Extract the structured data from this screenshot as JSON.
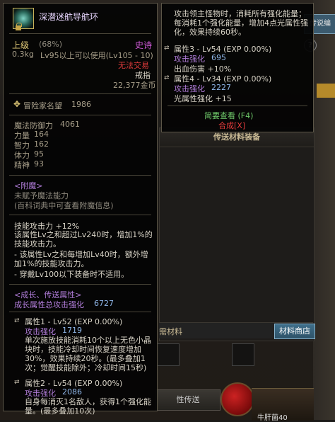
{
  "background": {
    "panel_title": "传送材料装备",
    "tab_label": "传说编",
    "help_label": "?",
    "materials_label": "需材料",
    "materials_shop": "材料商店",
    "bottom_button": "性传送",
    "hud_label": "牛肝菌40"
  },
  "tooltip": {
    "name": "深潜迷航导航环",
    "grade": "上级",
    "grade_pct": "(68%)",
    "rarity": "史诗",
    "weight": "0.3kg",
    "level_req": "Lv95以上可以使用(Lv105 - 10)",
    "trade": "无法交易",
    "slot": "戒指",
    "price": "22,377金币",
    "reputation_label": "冒险家名望",
    "reputation_value": "1986",
    "stats": [
      {
        "label": "魔法防御力",
        "value": "4061"
      },
      {
        "label": "力量",
        "value": "164"
      },
      {
        "label": "智力",
        "value": "162"
      },
      {
        "label": "体力",
        "value": "95"
      },
      {
        "label": "精神",
        "value": "93"
      }
    ],
    "enchant_header": "<附魔>",
    "enchant_none": "未赋予魔法能力",
    "enchant_hint": "(百科词典中可查看附魔信息)",
    "skill_line1": "技能攻击力 +12%",
    "skill_line2": "该属性Lv之和超过Lv240时，增加1%的技能攻击力。",
    "skill_line3": "- 该属性Lv之和每增加Lv40时，额外增加1%的技能攻击力。",
    "skill_line4": "- 穿戴Lv100以下装备时不适用。",
    "growth_header": "<成长、传送属性>",
    "growth_total_label": "成长属性总攻击强化",
    "growth_total_value": "6727",
    "attr1_header": "属性1 - Lv52 (EXP 0.00%)",
    "attr1_atk_label": "攻击强化",
    "attr1_atk_value": "1719",
    "attr1_desc": "单次施放技能消耗10个以上无色小晶块时，技能冷却时间恢复速度增加30%，效果持续20秒。(最多叠加1次；觉醒技能除外；冷却时间15秒)",
    "attr2_header": "属性2 - Lv54 (EXP 0.00%)",
    "attr2_atk_label": "攻击强化",
    "attr2_atk_value": "2086",
    "attr2_desc": "自身每消灭1名敌人，获得1个强化能量。(最多叠加10次)"
  },
  "side": {
    "desc": "攻击领主怪物时，消耗所有强化能量；每消耗1个强化能量，增加4点光属性强化，效果持续60秒。",
    "attr3_header": "属性3 - Lv54 (EXP 0.00%)",
    "attr3_atk_label": "攻击强化",
    "attr3_atk_value": "695",
    "attr3_effect": "出血伤害 +10%",
    "attr4_header": "属性4 - Lv34 (EXP 0.00%)",
    "attr4_atk_label": "攻击强化",
    "attr4_atk_value": "2227",
    "attr4_effect": "光属性强化 +15",
    "simple_view": "简要查看 (F4)",
    "compose": "合成[X]"
  }
}
